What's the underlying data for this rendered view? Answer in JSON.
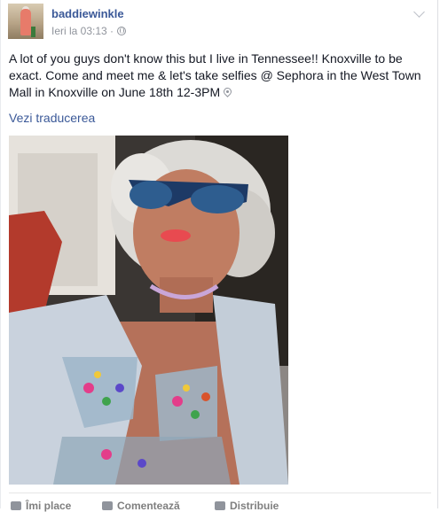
{
  "post": {
    "author": "baddiewinkle",
    "timestamp": "Ieri la 03:13 ·",
    "text": "A lot of you guys don't know this but I live in Tennessee!! Knoxville to be exact. Come and meet me & let's take selfies @ Sephora in the West Town Mall in Knoxville on June 18th 12-3PM",
    "translate_link": "Vezi traducerea",
    "audience_icon": "globe-icon",
    "location_icon": "location-pin-icon",
    "photo_icon": "photo"
  },
  "actions": {
    "like": "Îmi place",
    "comment": "Comentează",
    "share": "Distribuie"
  },
  "colors": {
    "link": "#3b5998",
    "text": "#141823",
    "meta": "#90949c"
  }
}
